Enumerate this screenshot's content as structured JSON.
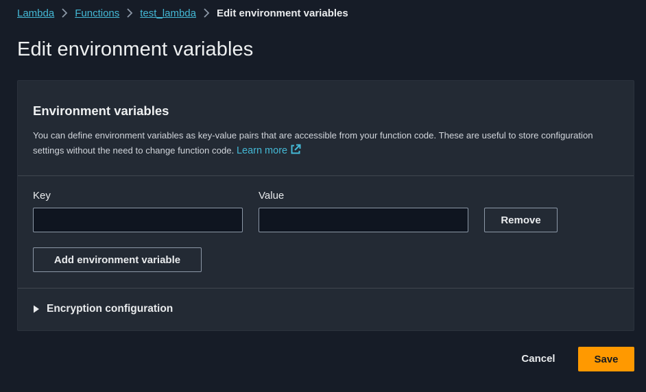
{
  "breadcrumb": {
    "items": [
      {
        "label": "Lambda"
      },
      {
        "label": "Functions"
      },
      {
        "label": "test_lambda"
      }
    ],
    "current": "Edit environment variables"
  },
  "page": {
    "title": "Edit environment variables"
  },
  "env_panel": {
    "title": "Environment variables",
    "description": "You can define environment variables as key-value pairs that are accessible from your function code. These are useful to store configuration settings without the need to change function code.",
    "learn_more": "Learn more",
    "key_label": "Key",
    "value_label": "Value",
    "key_value": "",
    "value_value": "",
    "remove_label": "Remove",
    "add_label": "Add environment variable",
    "encryption_label": "Encryption configuration"
  },
  "footer": {
    "cancel_label": "Cancel",
    "save_label": "Save"
  },
  "colors": {
    "background": "#161c27",
    "panel": "#232a34",
    "link": "#44b9d6",
    "primary_button": "#ff9900"
  },
  "icons": {
    "breadcrumb_separator": "chevron-right-icon",
    "external_link": "external-link-icon",
    "expand": "caret-right-icon"
  }
}
